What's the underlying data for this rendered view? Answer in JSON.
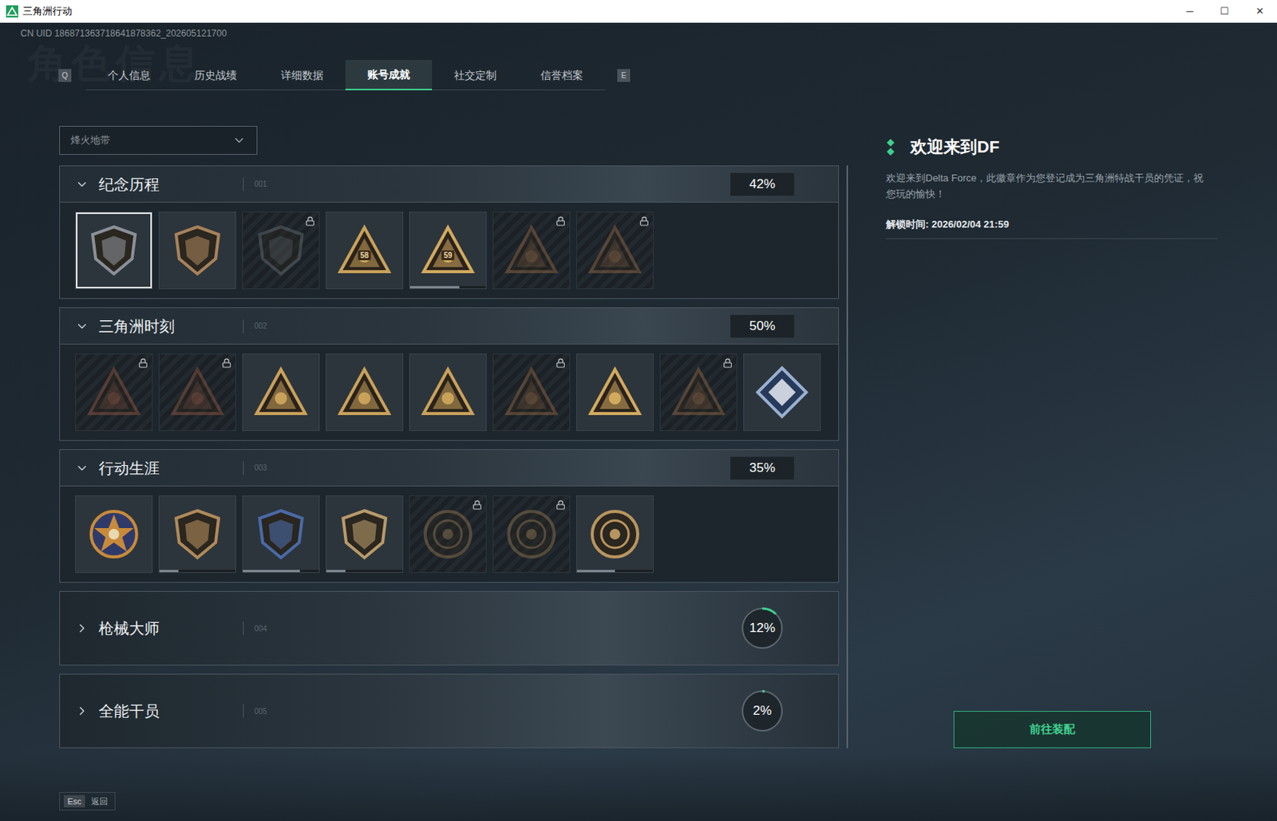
{
  "window": {
    "title": "三角洲行动",
    "controls": [
      "─",
      "☐",
      "✕"
    ]
  },
  "uid": "CN UID 186871363718641878362_202605121700",
  "watermark": "角色信息",
  "tab_keys": {
    "prev": "Q",
    "next": "E"
  },
  "tabs": [
    {
      "label": "个人信息",
      "selected": false
    },
    {
      "label": "历史战绩",
      "selected": false
    },
    {
      "label": "详细数据",
      "selected": false
    },
    {
      "label": "账号成就",
      "selected": true
    },
    {
      "label": "社交定制",
      "selected": false
    },
    {
      "label": "信誉档案",
      "selected": false
    }
  ],
  "mode_select": {
    "value": "烽火地带"
  },
  "sections": [
    {
      "title": "纪念历程",
      "index": "001",
      "percent": "42%",
      "expanded": true,
      "badges": [
        {
          "kind": "shield",
          "color": "#8a9096",
          "locked": false,
          "selected": true
        },
        {
          "kind": "shield",
          "color": "#a8825a",
          "locked": false,
          "selected": false
        },
        {
          "kind": "shield",
          "color": "#6a7076",
          "locked": true,
          "selected": false
        },
        {
          "kind": "triangle",
          "color": "#c9a25a",
          "locked": false,
          "selected": false,
          "label": "58"
        },
        {
          "kind": "triangle",
          "color": "#d2aa5e",
          "locked": false,
          "selected": false,
          "label": "59",
          "level": 0.65
        },
        {
          "kind": "triangle",
          "color": "#9a6a44",
          "locked": true,
          "selected": false
        },
        {
          "kind": "triangle",
          "color": "#9a6a44",
          "locked": true,
          "selected": false
        }
      ]
    },
    {
      "title": "三角洲时刻",
      "index": "002",
      "percent": "50%",
      "expanded": true,
      "badges": [
        {
          "kind": "triangle",
          "color": "#9a5a40",
          "locked": true,
          "selected": false
        },
        {
          "kind": "triangle",
          "color": "#9a5a40",
          "locked": true,
          "selected": false
        },
        {
          "kind": "triangle",
          "color": "#c9a25a",
          "locked": false,
          "selected": false
        },
        {
          "kind": "triangle",
          "color": "#c9a25a",
          "locked": false,
          "selected": false
        },
        {
          "kind": "triangle",
          "color": "#c9a25a",
          "locked": false,
          "selected": false
        },
        {
          "kind": "triangle",
          "color": "#9a6a44",
          "locked": true,
          "selected": false
        },
        {
          "kind": "triangle",
          "color": "#d2aa5e",
          "locked": false,
          "selected": false
        },
        {
          "kind": "triangle",
          "color": "#9a6a44",
          "locked": true,
          "selected": false
        },
        {
          "kind": "diamond",
          "color": "#9ab0d0",
          "locked": false,
          "selected": false
        }
      ]
    },
    {
      "title": "行动生涯",
      "index": "003",
      "percent": "35%",
      "expanded": true,
      "badges": [
        {
          "kind": "star",
          "color": "#c88a3a",
          "locked": false,
          "selected": false
        },
        {
          "kind": "shield",
          "color": "#b08a5a",
          "locked": false,
          "selected": false,
          "level": 0.25
        },
        {
          "kind": "shield",
          "color": "#4a6aa8",
          "locked": false,
          "selected": false,
          "level": 0.75
        },
        {
          "kind": "shield",
          "color": "#b89a6a",
          "locked": false,
          "selected": false,
          "level": 0.25
        },
        {
          "kind": "round",
          "color": "#9a7a50",
          "locked": true,
          "selected": false
        },
        {
          "kind": "round",
          "color": "#9a7a50",
          "locked": true,
          "selected": false
        },
        {
          "kind": "round",
          "color": "#b8955e",
          "locked": false,
          "selected": false,
          "level": 0.5
        }
      ]
    },
    {
      "title": "枪械大师",
      "index": "004",
      "percent": "12%",
      "level": 0.12,
      "expanded": false,
      "badges": []
    },
    {
      "title": "全能干员",
      "index": "005",
      "percent": "2%",
      "level": 0.02,
      "expanded": false,
      "badges": []
    }
  ],
  "detail": {
    "title": "欢迎来到DF",
    "description": "欢迎来到Delta Force，此徽章作为您登记成为三角洲特战干员的凭证，祝您玩的愉快！",
    "unlock_time": "解锁时间: 2026/02/04 21:59",
    "button": "前往装配"
  },
  "footer": {
    "key": "Esc",
    "label": "返回"
  }
}
